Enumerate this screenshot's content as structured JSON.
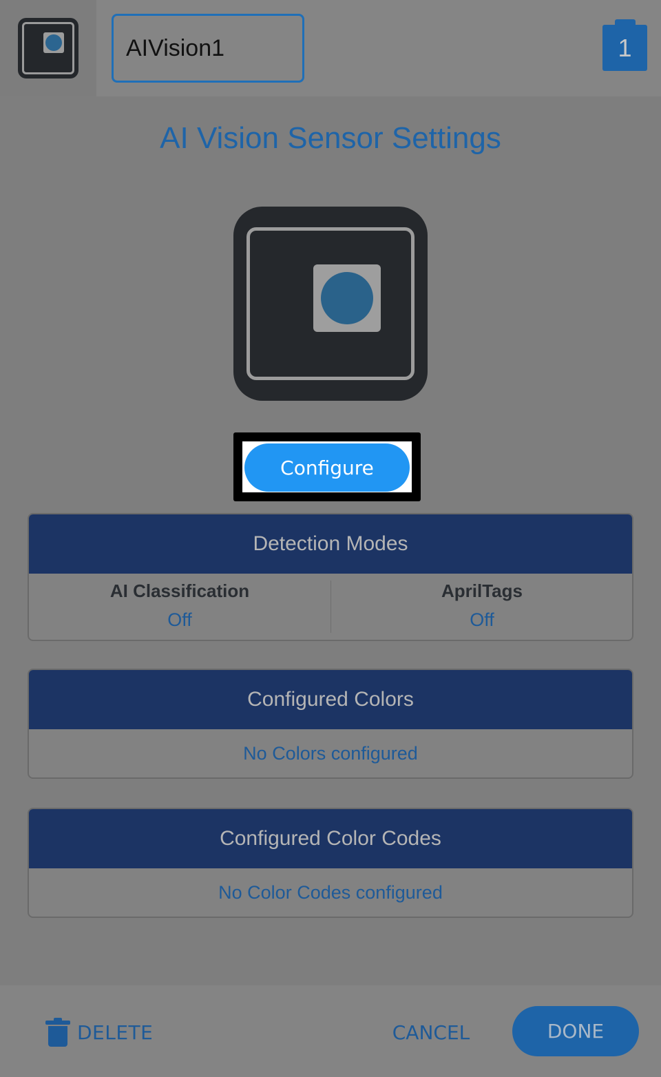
{
  "header": {
    "device_name_value": "AIVision1",
    "port_number": "1"
  },
  "title": "AI Vision Sensor Settings",
  "configure_label": "Configure",
  "detection_modes": {
    "header": "Detection Modes",
    "modes": [
      {
        "label": "AI Classification",
        "value": "Off"
      },
      {
        "label": "AprilTags",
        "value": "Off"
      }
    ]
  },
  "configured_colors": {
    "header": "Configured Colors",
    "empty_text": "No Colors configured"
  },
  "configured_color_codes": {
    "header": "Configured Color Codes",
    "empty_text": "No Color Codes configured"
  },
  "footer": {
    "delete_label": "DELETE",
    "cancel_label": "CANCEL",
    "done_label": "DONE"
  },
  "colors": {
    "accent": "#1e64a8",
    "configure_button": "#2196f3",
    "panel_header": "#1c3464"
  }
}
